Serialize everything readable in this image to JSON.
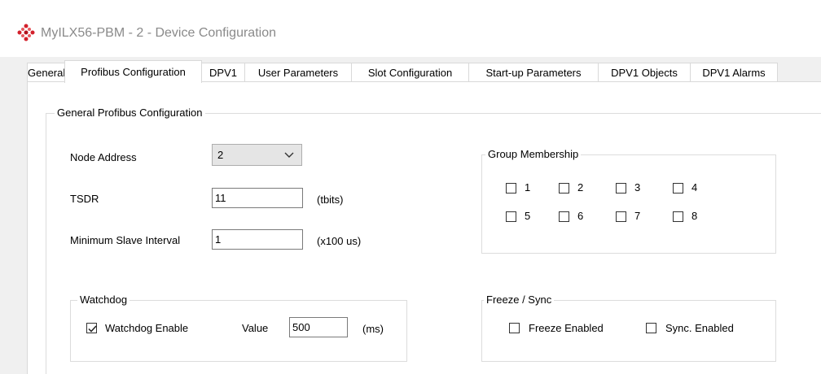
{
  "window": {
    "title": "MyILX56-PBM - 2 - Device Configuration"
  },
  "tabs": [
    {
      "label": "General"
    },
    {
      "label": "Profibus Configuration"
    },
    {
      "label": "DPV1"
    },
    {
      "label": "User Parameters"
    },
    {
      "label": "Slot Configuration"
    },
    {
      "label": "Start-up Parameters"
    },
    {
      "label": "DPV1 Objects"
    },
    {
      "label": "DPV1 Alarms"
    }
  ],
  "active_tab": "Profibus Configuration",
  "general": {
    "legend": "General Profibus Configuration",
    "node_address_label": "Node Address",
    "node_address_value": "2",
    "tsdr_label": "TSDR",
    "tsdr_value": "11",
    "tsdr_unit": "(tbits)",
    "min_slave_label": "Minimum Slave Interval",
    "min_slave_value": "1",
    "min_slave_unit": "(x100 us)"
  },
  "group": {
    "legend": "Group Membership",
    "items": [
      {
        "label": "1",
        "checked": false
      },
      {
        "label": "2",
        "checked": false
      },
      {
        "label": "3",
        "checked": false
      },
      {
        "label": "4",
        "checked": false
      },
      {
        "label": "5",
        "checked": false
      },
      {
        "label": "6",
        "checked": false
      },
      {
        "label": "7",
        "checked": false
      },
      {
        "label": "8",
        "checked": false
      }
    ]
  },
  "watchdog": {
    "legend": "Watchdog",
    "enable_label": "Watchdog Enable",
    "enabled": true,
    "value_label": "Value",
    "value": "500",
    "unit": "(ms)"
  },
  "freeze": {
    "legend": "Freeze / Sync",
    "freeze_label": "Freeze Enabled",
    "freeze_checked": false,
    "sync_label": "Sync. Enabled",
    "sync_checked": false
  },
  "icons": {
    "app": "diamond-dots-icon",
    "dropdown": "chevron-down-icon",
    "check": "checkmark-icon"
  }
}
